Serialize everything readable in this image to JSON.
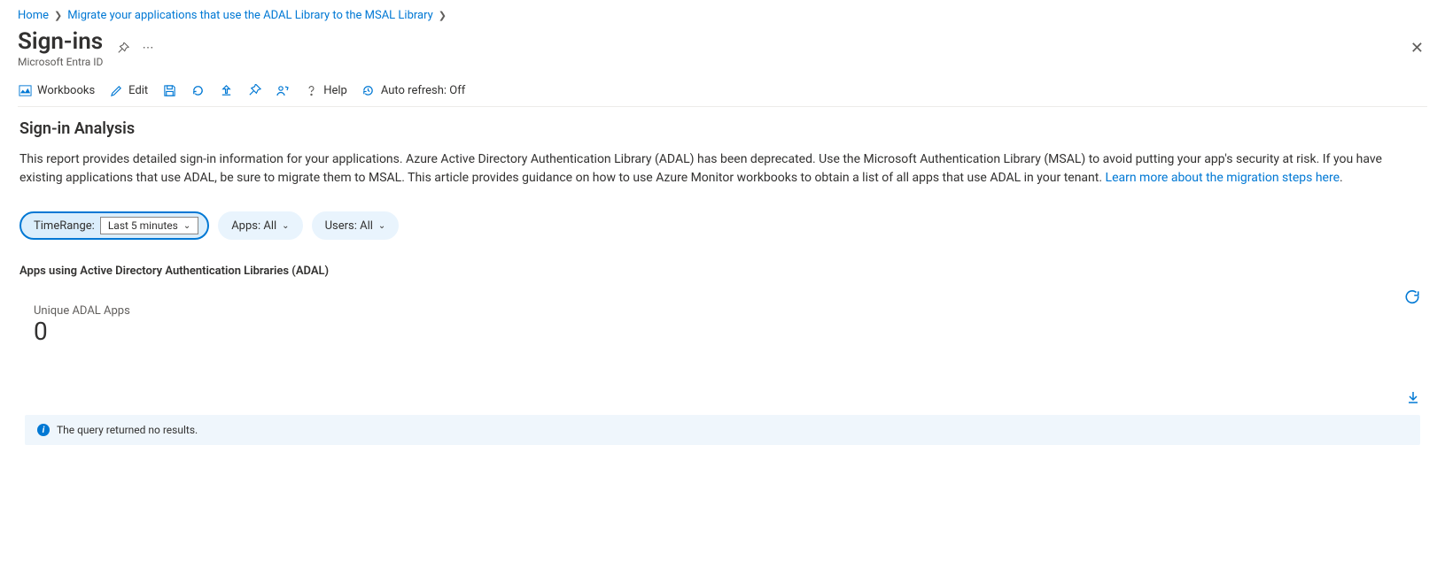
{
  "breadcrumb": {
    "home": "Home",
    "migrate": "Migrate your applications that use the ADAL Library to the MSAL Library"
  },
  "header": {
    "title": "Sign-ins",
    "subtitle": "Microsoft Entra ID"
  },
  "toolbar": {
    "workbooks": "Workbooks",
    "edit": "Edit",
    "help": "Help",
    "autorefresh": "Auto refresh: Off"
  },
  "content": {
    "heading": "Sign-in Analysis",
    "description": "This report provides detailed sign-in information for your applications. Azure Active Directory Authentication Library (ADAL) has been deprecated. Use the Microsoft Authentication Library (MSAL) to avoid putting your app's security at risk. If you have existing applications that use ADAL, be sure to migrate them to MSAL. This article provides guidance on how to use Azure Monitor workbooks to obtain a list of all apps that use ADAL in your tenant. ",
    "learn_link": "Learn more about the migration steps here",
    "period": "."
  },
  "filters": {
    "timerange_label": "TimeRange:",
    "timerange_value": "Last 5 minutes",
    "apps_label": "Apps: All",
    "users_label": "Users: All"
  },
  "section": {
    "apps_heading": "Apps using Active Directory Authentication Libraries (ADAL)",
    "metric_label": "Unique ADAL Apps",
    "metric_value": "0"
  },
  "results": {
    "info": "The query returned no results."
  }
}
